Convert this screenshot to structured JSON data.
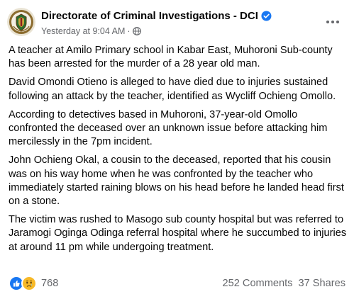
{
  "post": {
    "page_name": "Directorate of Criminal Investigations - DCI",
    "timestamp": "Yesterday at 9:04 AM",
    "separator": "·",
    "audience_icon": "globe-icon",
    "verified_icon": "verified-badge-icon",
    "more_icon": "more-horizontal-icon",
    "paragraphs": [
      "A teacher at Amilo Primary school in Kabar East, Muhoroni Sub-county has been arrested for the murder of a 28 year old man.",
      "David Omondi Otieno is alleged to have died due to injuries sustained following an attack by the teacher, identified as Wycliff Ochieng Omollo.",
      "According to detectives based in Muhoroni, 37-year-old Omollo confronted the deceased over an unknown issue before attacking him mercilessly in the 7pm incident.",
      "John Ochieng Okal, a cousin to the deceased, reported that his cousin was on his way home when he was confronted by the teacher who immediately started raining blows on his head before he landed head first on a stone.",
      "The victim was rushed to Masogo sub county hospital but was referred to Jaramogi Oginga Odinga referral hospital where he succumbed to injuries at around 11 pm  while undergoing treatment."
    ],
    "reactions": {
      "icons": [
        "like-reaction-icon",
        "sad-reaction-icon"
      ],
      "count": "768"
    },
    "comments": "252 Comments",
    "shares": "37 Shares"
  },
  "colors": {
    "text": "#050505",
    "secondary_text": "#65676b",
    "brand_blue": "#1877f2",
    "sad_yellow": "#f7b928"
  }
}
